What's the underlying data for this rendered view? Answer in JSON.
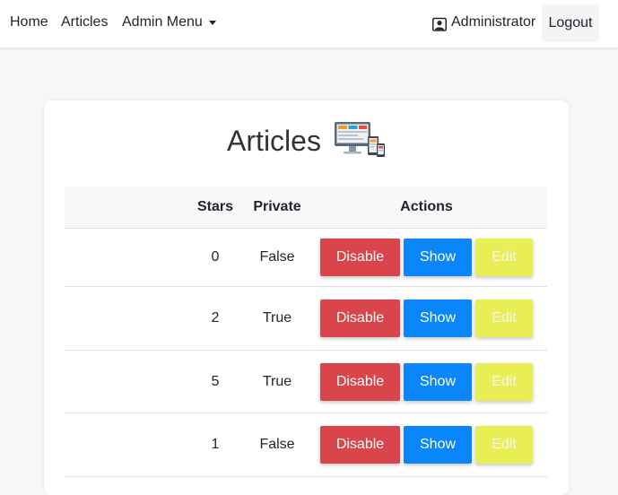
{
  "navbar": {
    "home": "Home",
    "articles": "Articles",
    "admin_menu": "Admin Menu",
    "user": "Administrator",
    "logout": "Logout"
  },
  "card": {
    "title": "Articles",
    "columns": {
      "stars": "Stars",
      "private": "Private",
      "actions": "Actions"
    },
    "rows": [
      {
        "stars": "0",
        "private": "False",
        "disable": "Disable",
        "show": "Show",
        "edit": "Edit"
      },
      {
        "stars": "2",
        "private": "True",
        "disable": "Disable",
        "show": "Show",
        "edit": "Edit"
      },
      {
        "stars": "5",
        "private": "True",
        "disable": "Disable",
        "show": "Show",
        "edit": "Edit"
      },
      {
        "stars": "1",
        "private": "False",
        "disable": "Disable",
        "show": "Show",
        "edit": "Edit"
      }
    ]
  },
  "icons": {
    "user": "user-icon",
    "devices": "devices-icon",
    "caret": "chevron-down-icon"
  },
  "colors": {
    "disable": "#d9454a",
    "show": "#0a86fb",
    "edit": "#eaee55"
  }
}
